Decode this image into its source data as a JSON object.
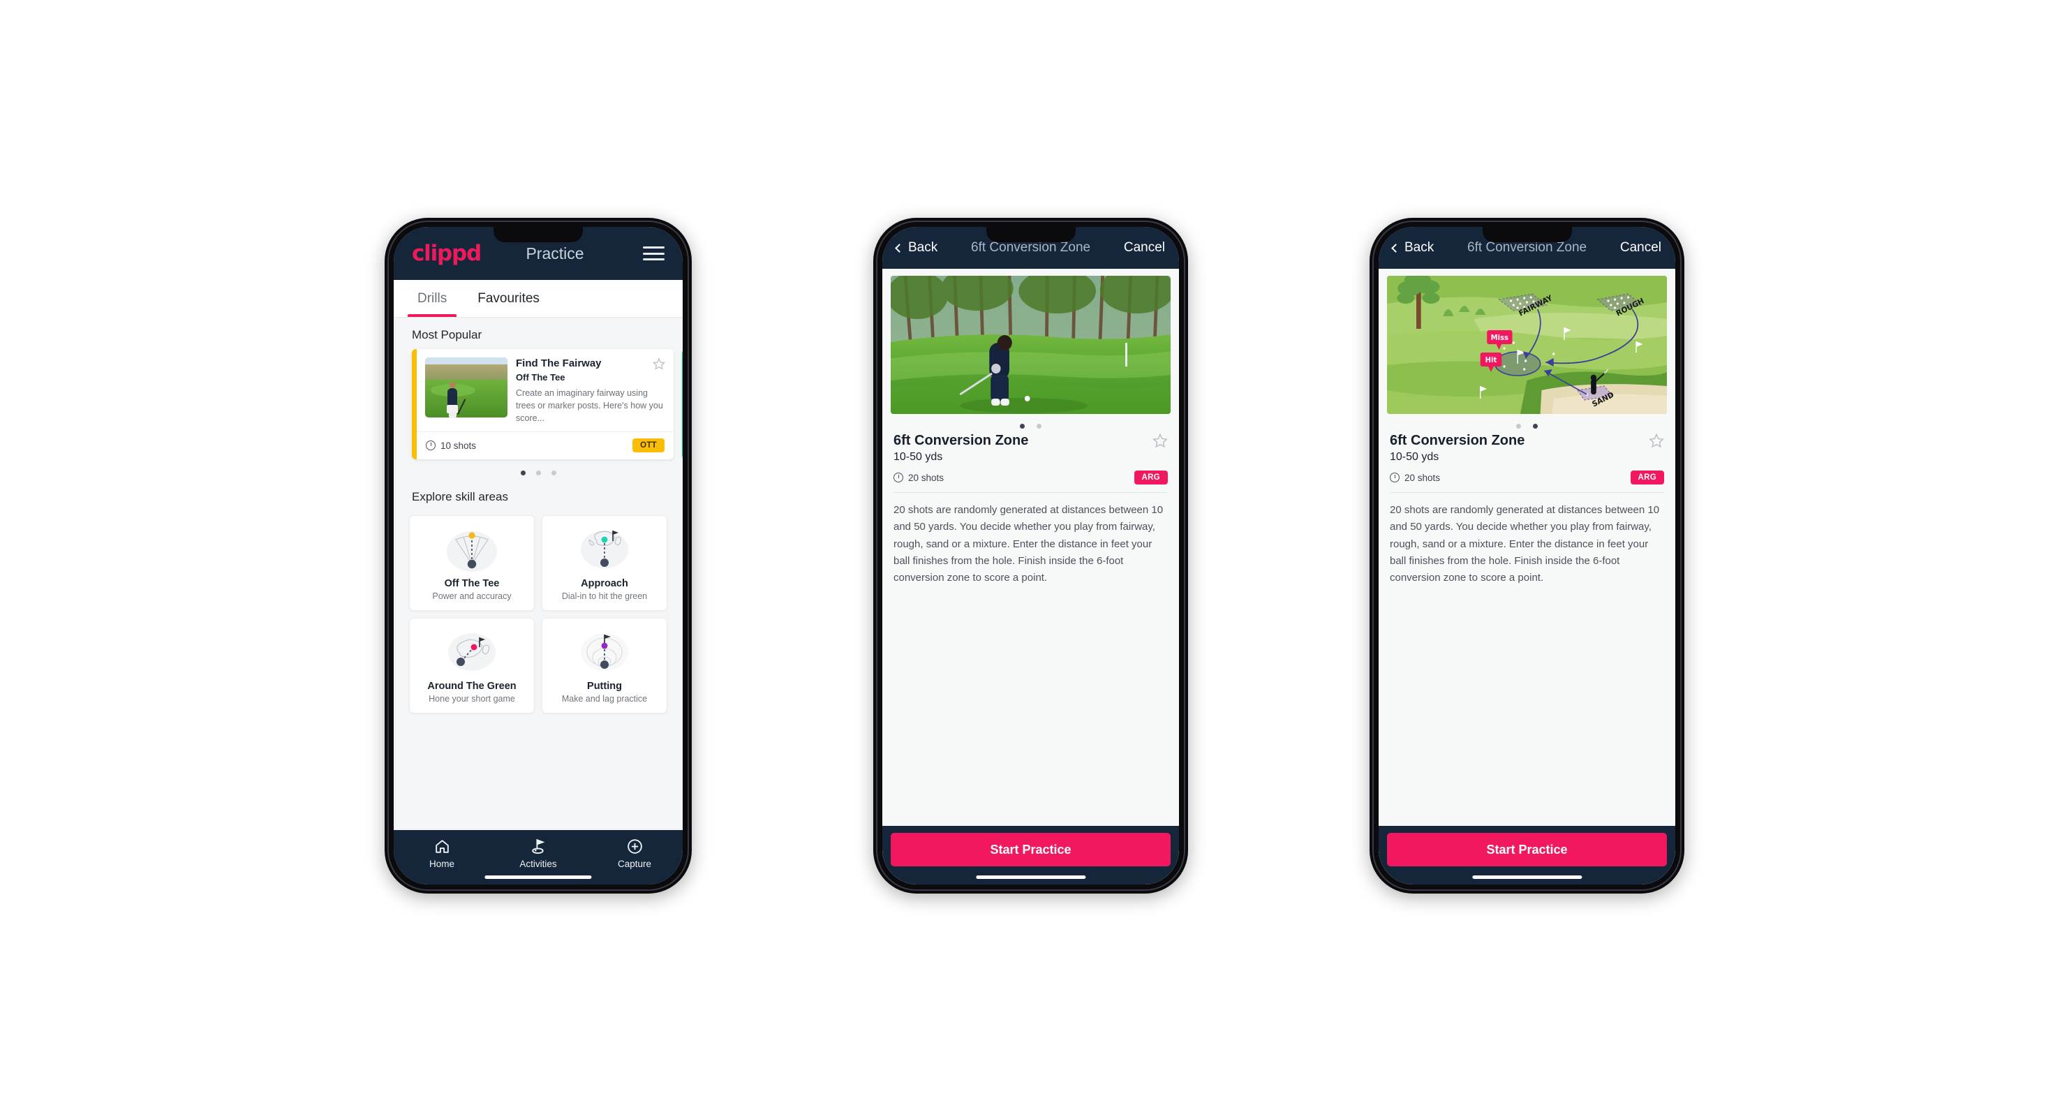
{
  "app": {
    "brand": "clippd",
    "accent_pink": "#ef1a5c",
    "navy": "#16263a",
    "amber": "#fbbd08",
    "teal": "#19d3b6"
  },
  "phone1": {
    "header": {
      "logo": "clippd",
      "title": "Practice",
      "menu_icon": "hamburger-menu-icon"
    },
    "tabs": [
      {
        "label": "Drills",
        "active": true
      },
      {
        "label": "Favourites",
        "active": false
      }
    ],
    "most_popular": {
      "section_label": "Most Popular",
      "cards": [
        {
          "title": "Find The Fairway",
          "subtitle": "Off The Tee",
          "description": "Create an imaginary fairway using trees or marker posts. Here's how you score...",
          "shots": "10 shots",
          "chip": "OTT",
          "chip_color": "#fbbd08",
          "stripe_color": "#fbbd08",
          "favourite": false
        }
      ],
      "carousel_dots": 3,
      "carousel_active": 0
    },
    "explore": {
      "section_label": "Explore skill areas",
      "items": [
        {
          "name": "Off The Tee",
          "desc": "Power and accuracy",
          "icon": "tee-fan-icon",
          "dot_color": "#f6b718"
        },
        {
          "name": "Approach",
          "desc": "Dial-in to hit the green",
          "icon": "approach-green-icon",
          "dot_color": "#1bd5b5"
        },
        {
          "name": "Around The Green",
          "desc": "Hone your short game",
          "icon": "around-green-icon",
          "dot_color": "#f2185f"
        },
        {
          "name": "Putting",
          "desc": "Make and lag practice",
          "icon": "putting-rings-icon",
          "dot_color": "#9327c9"
        }
      ]
    },
    "bottom_nav": [
      {
        "label": "Home",
        "icon": "home-icon",
        "active": false
      },
      {
        "label": "Activities",
        "icon": "golf-flag-icon",
        "active": true
      },
      {
        "label": "Capture",
        "icon": "plus-circle-icon",
        "active": false
      }
    ]
  },
  "phone2": {
    "navbar": {
      "back": "Back",
      "title": "6ft Conversion Zone",
      "cancel": "Cancel"
    },
    "hero": {
      "type": "photo",
      "alt": "golfer-chipping-photo"
    },
    "carousel_dots": 2,
    "carousel_active": 0,
    "detail": {
      "title": "6ft Conversion Zone",
      "subtitle": "10-50 yds",
      "shots": "20 shots",
      "chip": "ARG",
      "chip_color": "#f2185f",
      "favourite": false,
      "description": "20 shots are randomly generated at distances between 10 and 50 yards. You decide whether you play from fairway, rough, sand or a mixture. Enter the distance in feet your ball finishes from the hole. Finish inside the 6-foot conversion zone to score a point."
    },
    "cta": "Start Practice"
  },
  "phone3": {
    "navbar": {
      "back": "Back",
      "title": "6ft Conversion Zone",
      "cancel": "Cancel"
    },
    "hero": {
      "type": "diagram",
      "alt": "golf-course-diagram",
      "labels": [
        "FAIRWAY",
        "ROUGH",
        "SAND"
      ],
      "callouts": [
        "Miss",
        "Hit"
      ],
      "callout_color": "#f2185f"
    },
    "carousel_dots": 2,
    "carousel_active": 1,
    "detail": {
      "title": "6ft Conversion Zone",
      "subtitle": "10-50 yds",
      "shots": "20 shots",
      "chip": "ARG",
      "chip_color": "#f2185f",
      "favourite": false,
      "description": "20 shots are randomly generated at distances between 10 and 50 yards. You decide whether you play from fairway, rough, sand or a mixture. Enter the distance in feet your ball finishes from the hole. Finish inside the 6-foot conversion zone to score a point."
    },
    "cta": "Start Practice"
  }
}
